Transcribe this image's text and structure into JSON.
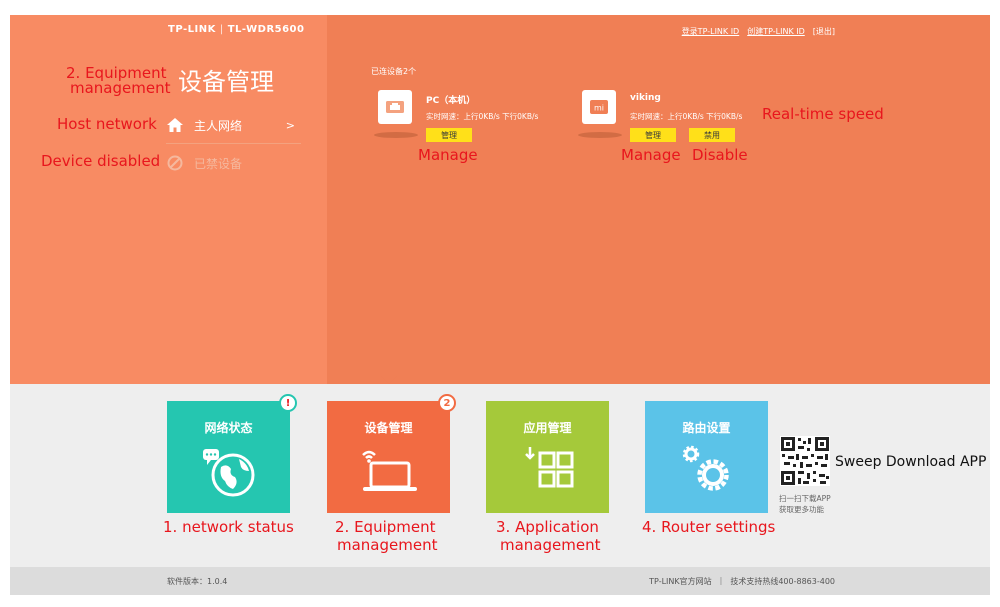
{
  "header": {
    "brand": "TP-LINK",
    "model": "TL-WDR5600",
    "links": [
      "登录TP-LINK ID",
      "创建TP-LINK ID",
      "[退出]"
    ]
  },
  "sidebar": {
    "title": "设备管理",
    "items": [
      {
        "label": "主人网络",
        "icon": "home-icon",
        "chevron": ">"
      },
      {
        "label": "已禁设备",
        "icon": "block-icon"
      }
    ]
  },
  "main": {
    "connected_label": "已连设备2个",
    "devices": [
      {
        "name": "PC（本机）",
        "speed": "实时网速：上行0KB/s  下行0KB/s",
        "buttons": [
          "管理"
        ],
        "icon": "ethernet-port-icon"
      },
      {
        "name": "viking",
        "speed": "实时网速：上行0KB/s  下行0KB/s",
        "buttons": [
          "管理",
          "禁用"
        ],
        "icon": "mi-logo-icon"
      }
    ]
  },
  "tiles": [
    {
      "label": "网络状态",
      "color": "#25c6b0",
      "icon": "globe-icon",
      "badge": "!"
    },
    {
      "label": "设备管理",
      "color": "#f26b42",
      "icon": "laptop-wifi-icon",
      "badge": "2"
    },
    {
      "label": "应用管理",
      "color": "#a5c93a",
      "icon": "apps-grid-icon"
    },
    {
      "label": "路由设置",
      "color": "#5bc3e8",
      "icon": "gear-icon"
    }
  ],
  "qr": {
    "text_line1": "扫一扫下载APP",
    "text_line2": "获取更多功能"
  },
  "footer": {
    "version": "软件版本：1.0.4",
    "official_site": "TP-LINK官方网站",
    "hotline": "技术支持热线400-8863-400"
  },
  "annotations": {
    "equipment_management_1": "2. Equipment",
    "equipment_management_2": "management",
    "host_network": "Host network",
    "device_disabled": "Device disabled",
    "manage_1": "Manage",
    "manage_2": "Manage",
    "disable": "Disable",
    "realtime_speed": "Real-time speed",
    "tile1": "1. network status",
    "tile2_1": "2. Equipment",
    "tile2_2": "management",
    "tile3_1": "3. Application",
    "tile3_2": "management",
    "tile4": "4. Router settings",
    "sweep": "Sweep Download APP"
  },
  "colors": {
    "panel": "#f07f55",
    "sidebar": "#f88b63",
    "button": "#ffe019",
    "annotation": "#e8161d"
  }
}
